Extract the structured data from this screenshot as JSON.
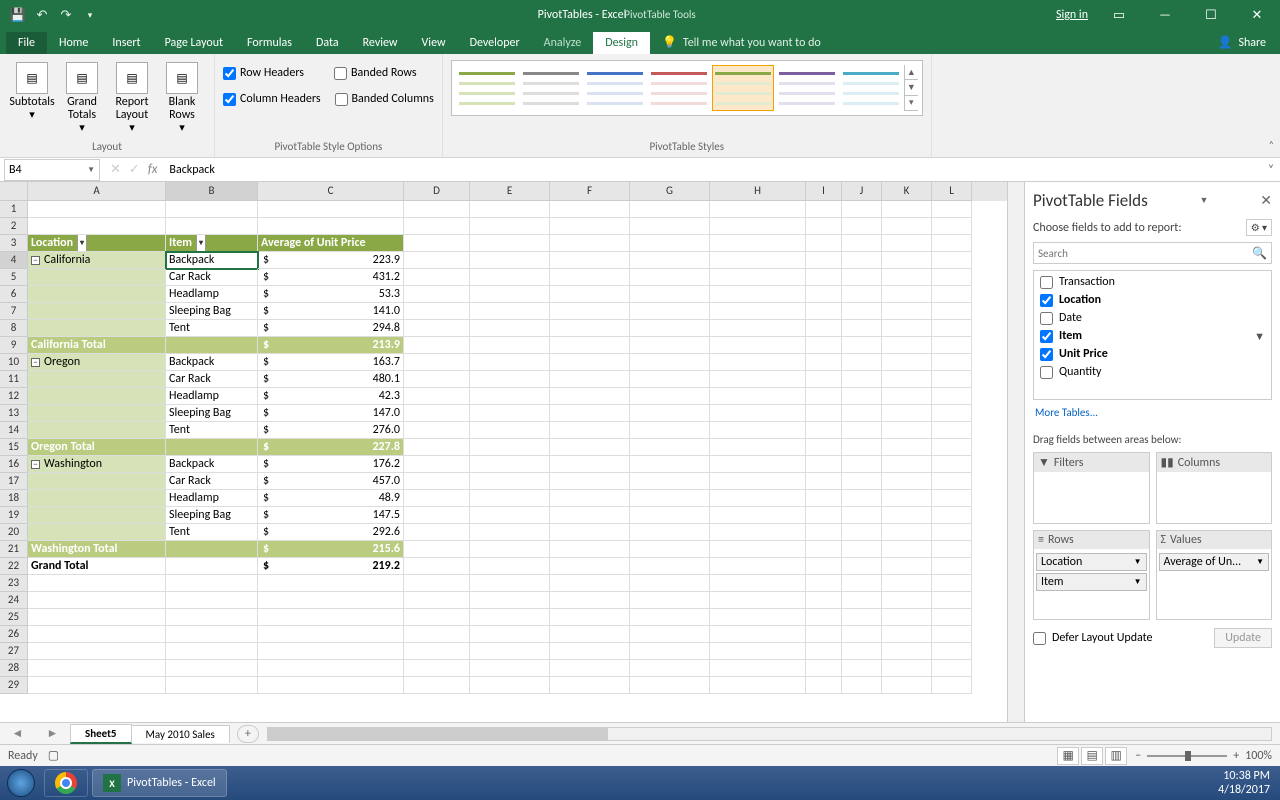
{
  "window": {
    "title_left": "PivotTables - Excel",
    "tool_context": "PivotTable Tools",
    "signin": "Sign in"
  },
  "tabs": [
    "File",
    "Home",
    "Insert",
    "Page Layout",
    "Formulas",
    "Data",
    "Review",
    "View",
    "Developer",
    "Analyze",
    "Design"
  ],
  "active_tab": "Design",
  "tell_me": "Tell me what you want to do",
  "share": "Share",
  "ribbon": {
    "layout_group": "Layout",
    "subtotals": "Subtotals",
    "grand_totals": "Grand Totals",
    "report_layout": "Report Layout",
    "blank_rows": "Blank Rows",
    "opts_group": "PivotTable Style Options",
    "row_headers": "Row Headers",
    "column_headers": "Column Headers",
    "banded_rows": "Banded Rows",
    "banded_columns": "Banded Columns",
    "styles_group": "PivotTable Styles"
  },
  "namebox": "B4",
  "formula": "Backpack",
  "columns": [
    "A",
    "B",
    "C",
    "D",
    "E",
    "F",
    "G",
    "H",
    "I",
    "J",
    "K",
    "L"
  ],
  "pivot": {
    "headers": {
      "a": "Location",
      "b": "Item",
      "c": "Average of Unit Price"
    },
    "groups": [
      {
        "name": "California",
        "rows": [
          {
            "item": "Backpack",
            "val": "223.9"
          },
          {
            "item": "Car Rack",
            "val": "431.2"
          },
          {
            "item": "Headlamp",
            "val": "53.3"
          },
          {
            "item": "Sleeping Bag",
            "val": "141.0"
          },
          {
            "item": "Tent",
            "val": "294.8"
          }
        ],
        "total_label": "California Total",
        "total": "213.9"
      },
      {
        "name": "Oregon",
        "rows": [
          {
            "item": "Backpack",
            "val": "163.7"
          },
          {
            "item": "Car Rack",
            "val": "480.1"
          },
          {
            "item": "Headlamp",
            "val": "42.3"
          },
          {
            "item": "Sleeping Bag",
            "val": "147.0"
          },
          {
            "item": "Tent",
            "val": "276.0"
          }
        ],
        "total_label": "Oregon Total",
        "total": "227.8"
      },
      {
        "name": "Washington",
        "rows": [
          {
            "item": "Backpack",
            "val": "176.2"
          },
          {
            "item": "Car Rack",
            "val": "457.0"
          },
          {
            "item": "Headlamp",
            "val": "48.9"
          },
          {
            "item": "Sleeping Bag",
            "val": "147.5"
          },
          {
            "item": "Tent",
            "val": "292.6"
          }
        ],
        "total_label": "Washington Total",
        "total": "215.6"
      }
    ],
    "grand_label": "Grand Total",
    "grand_total": "219.2"
  },
  "fieldpane": {
    "title": "PivotTable Fields",
    "subtitle": "Choose fields to add to report:",
    "search_placeholder": "Search",
    "fields": [
      {
        "name": "Transaction",
        "checked": false
      },
      {
        "name": "Location",
        "checked": true
      },
      {
        "name": "Date",
        "checked": false
      },
      {
        "name": "Item",
        "checked": true,
        "filtered": true
      },
      {
        "name": "Unit Price",
        "checked": true
      },
      {
        "name": "Quantity",
        "checked": false
      }
    ],
    "more": "More Tables...",
    "drag_label": "Drag fields between areas below:",
    "areas": {
      "filters": "Filters",
      "columns": "Columns",
      "rows": "Rows",
      "values": "Values"
    },
    "row_chips": [
      "Location",
      "Item"
    ],
    "value_chips": [
      "Average of Un..."
    ],
    "defer": "Defer Layout Update",
    "update": "Update"
  },
  "sheets": {
    "active": "Sheet5",
    "other": "May 2010 Sales"
  },
  "status": {
    "ready": "Ready",
    "zoom": "100%"
  },
  "taskbar": {
    "app": "PivotTables - Excel",
    "time": "10:38 PM",
    "date": "4/18/2017"
  }
}
